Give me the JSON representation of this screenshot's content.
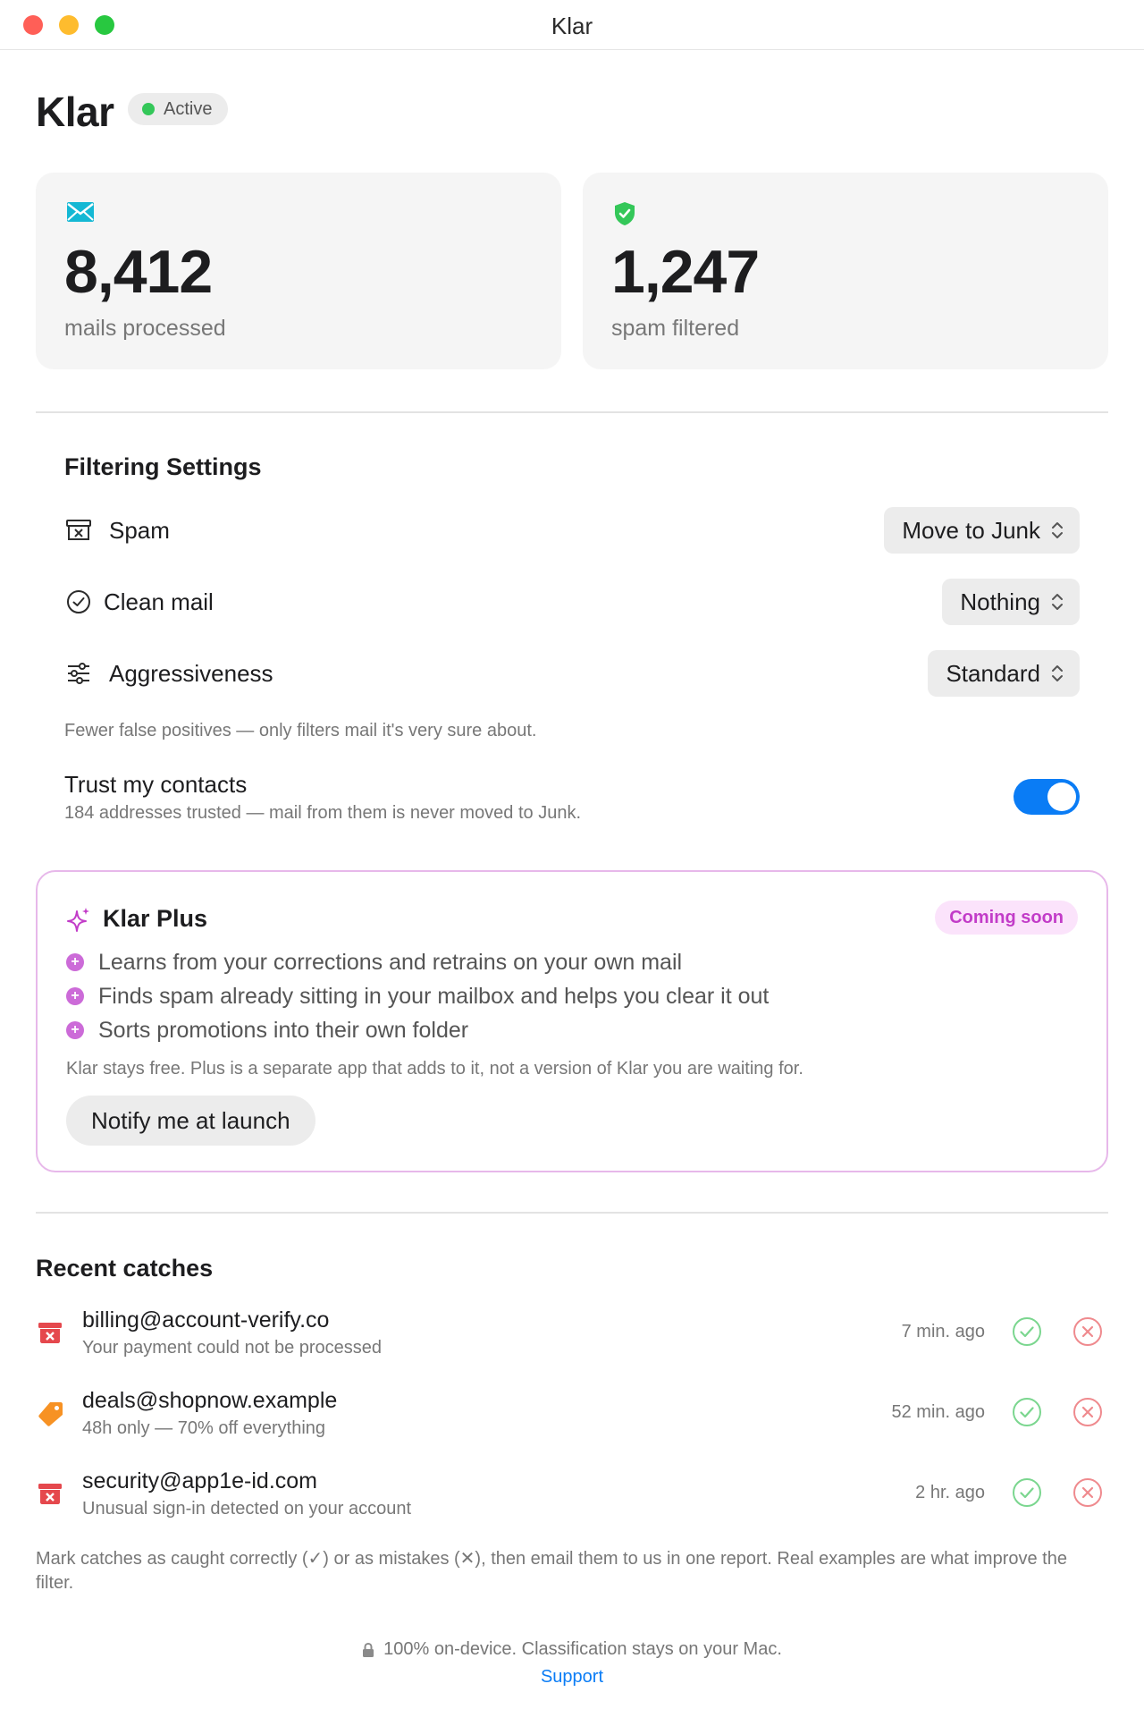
{
  "window": {
    "title": "Klar"
  },
  "header": {
    "title": "Klar",
    "status": "Active"
  },
  "stats": {
    "mails": {
      "value": "8,412",
      "label": "mails processed",
      "icon": "envelope-icon"
    },
    "spam": {
      "value": "1,247",
      "label": "spam filtered",
      "icon": "shield-check-icon"
    }
  },
  "filtering": {
    "title": "Filtering Settings",
    "spam": {
      "label": "Spam",
      "value": "Move to Junk",
      "icon": "junk-box-icon"
    },
    "clean": {
      "label": "Clean mail",
      "value": "Nothing",
      "icon": "checkmark-circle-icon"
    },
    "aggressiveness": {
      "label": "Aggressiveness",
      "value": "Standard",
      "icon": "sliders-icon"
    },
    "hint": "Fewer false positives — only filters mail it's very sure about.",
    "trust": {
      "title": "Trust my contacts",
      "subtitle": "184 addresses trusted — mail from them is never moved to Junk.",
      "enabled": true
    }
  },
  "plus": {
    "title": "Klar Plus",
    "badge": "Coming soon",
    "features": [
      "Learns from your corrections and retrains on your own mail",
      "Finds spam already sitting in your mailbox and helps you clear it out",
      "Sorts promotions into their own folder"
    ],
    "note": "Klar stays free. Plus is a separate app that adds to it, not a version of Klar you are waiting for.",
    "button": "Notify me at launch"
  },
  "recent": {
    "title": "Recent catches",
    "items": [
      {
        "sender": "billing@account-verify.co",
        "subject": "Your payment could not be processed",
        "time": "7 min. ago",
        "icon": "junk-icon"
      },
      {
        "sender": "deals@shopnow.example",
        "subject": "48h only — 70% off everything",
        "time": "52 min. ago",
        "icon": "tag-icon"
      },
      {
        "sender": "security@app1e-id.com",
        "subject": "Unusual sign-in detected on your account",
        "time": "2 hr. ago",
        "icon": "junk-icon"
      }
    ],
    "note": "Mark catches as caught correctly (✓) or as mistakes (✕), then email them to us in one report. Real examples are what improve the filter."
  },
  "footer": {
    "privacy": "100% on-device. Classification stays on your Mac.",
    "support": "Support"
  },
  "colors": {
    "accent": "#0a7cf5",
    "active": "#34c759",
    "plus": "#c23cc8",
    "danger": "#e5484d",
    "success": "#34c759"
  }
}
